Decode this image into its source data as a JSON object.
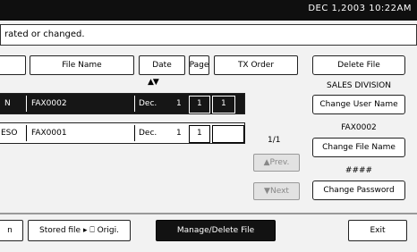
{
  "status": {
    "datetime": "DEC   1,2003 10:22AM"
  },
  "message": "rated or changed.",
  "headers": {
    "col_blank": "",
    "file_name": "File Name",
    "date": "Date",
    "page": "Page",
    "tx_order": "TX Order"
  },
  "sort_arrows": "▲▼",
  "rows": [
    {
      "user": "N",
      "file": "FAX0002",
      "date_m": "Dec.",
      "date_d": "1",
      "page": "1",
      "order": "1",
      "selected": true
    },
    {
      "user": "ESO",
      "file": "FAX0001",
      "date_m": "Dec.",
      "date_d": "1",
      "page": "1",
      "order": "",
      "selected": false
    }
  ],
  "page_indicator": "1/1",
  "prev_label": "▲Prev.",
  "next_label": "▼Next",
  "side": {
    "delete_file": "Delete File",
    "user_name": "SALES DIVISION",
    "change_user_name": "Change User Name",
    "file_name": "FAX0002",
    "change_file_name": "Change File Name",
    "password": "####",
    "change_password": "Change Password"
  },
  "bottom": {
    "partial": "n",
    "stored_file": "Stored file ▸ ⎕ Origi.",
    "manage": "Manage/Delete File",
    "exit": "Exit"
  }
}
